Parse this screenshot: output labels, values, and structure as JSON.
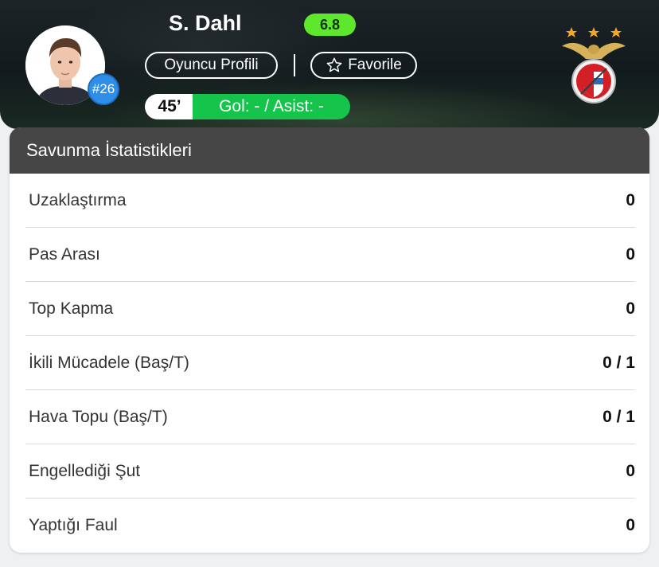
{
  "player": {
    "name": "S. Dahl",
    "rating": "6.8",
    "jersey": "#26",
    "minute": "45’",
    "goals_assists": "Gol: - / Asist: -"
  },
  "actions": {
    "profile_label": "Oyuncu Profili",
    "favorite_label": "Favorile",
    "favorite_icon": "star-outline-icon"
  },
  "colors": {
    "rating_bg": "#5ee82c",
    "goals_bg": "#15c44a",
    "jersey_bg": "#2f8fe8",
    "card_header_bg": "#464646"
  },
  "stats": {
    "title": "Savunma İstatistikleri",
    "rows": [
      {
        "label": "Uzaklaştırma",
        "value": "0"
      },
      {
        "label": "Pas Arası",
        "value": "0"
      },
      {
        "label": "Top Kapma",
        "value": "0"
      },
      {
        "label": "İkili Mücadele (Baş/T)",
        "value": "0 / 1"
      },
      {
        "label": "Hava Topu (Baş/T)",
        "value": "0 / 1"
      },
      {
        "label": "Engellediği Şut",
        "value": "0"
      },
      {
        "label": "Yaptığı Faul",
        "value": "0"
      }
    ]
  }
}
